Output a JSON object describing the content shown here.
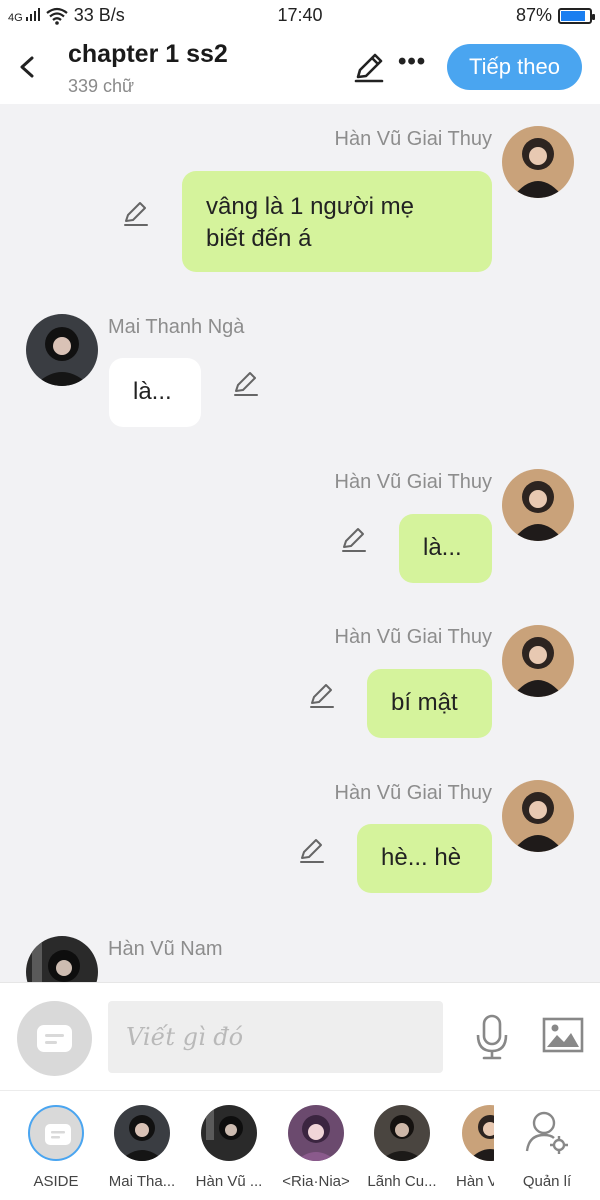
{
  "status_bar": {
    "network": "4G",
    "speed": "33 B/s",
    "time": "17:40",
    "battery": "87%",
    "battery_level": 0.87
  },
  "header": {
    "title": "chapter 1 ss2",
    "word_count": "339 chữ",
    "next_label": "Tiếp theo",
    "more_label": "•••"
  },
  "messages": [
    {
      "sender": "Hàn Vũ Giai Thuy",
      "text_lines": [
        "vâng là 1 người mẹ",
        "biết đến á"
      ],
      "side": "right"
    },
    {
      "sender": "Mai Thanh Ngà",
      "text_lines": [
        "là..."
      ],
      "side": "left"
    },
    {
      "sender": "Hàn Vũ Giai Thuy",
      "text_lines": [
        "là..."
      ],
      "side": "right"
    },
    {
      "sender": "Hàn Vũ Giai Thuy",
      "text_lines": [
        "bí mật"
      ],
      "side": "right"
    },
    {
      "sender": "Hàn Vũ Giai Thuy",
      "text_lines": [
        "hè... hè"
      ],
      "side": "right"
    },
    {
      "sender": "Hàn Vũ Nam",
      "text_lines": [],
      "side": "left"
    }
  ],
  "composer": {
    "placeholder": "Viết gì đó"
  },
  "characters": [
    {
      "name": "ASIDE"
    },
    {
      "name": "Mai Tha..."
    },
    {
      "name": "Hàn Vũ ..."
    },
    {
      "name": "<Ria·Nia>"
    },
    {
      "name": "Lãnh Cu..."
    },
    {
      "name": "Hàn V"
    },
    {
      "name": "Quản lí"
    }
  ],
  "colors": {
    "accent": "#4aa5f0",
    "my_bubble": "#d5f39c",
    "other_bubble": "#ffffff",
    "chat_background": "#f2f2f4",
    "battery": "#1a7ef0"
  }
}
